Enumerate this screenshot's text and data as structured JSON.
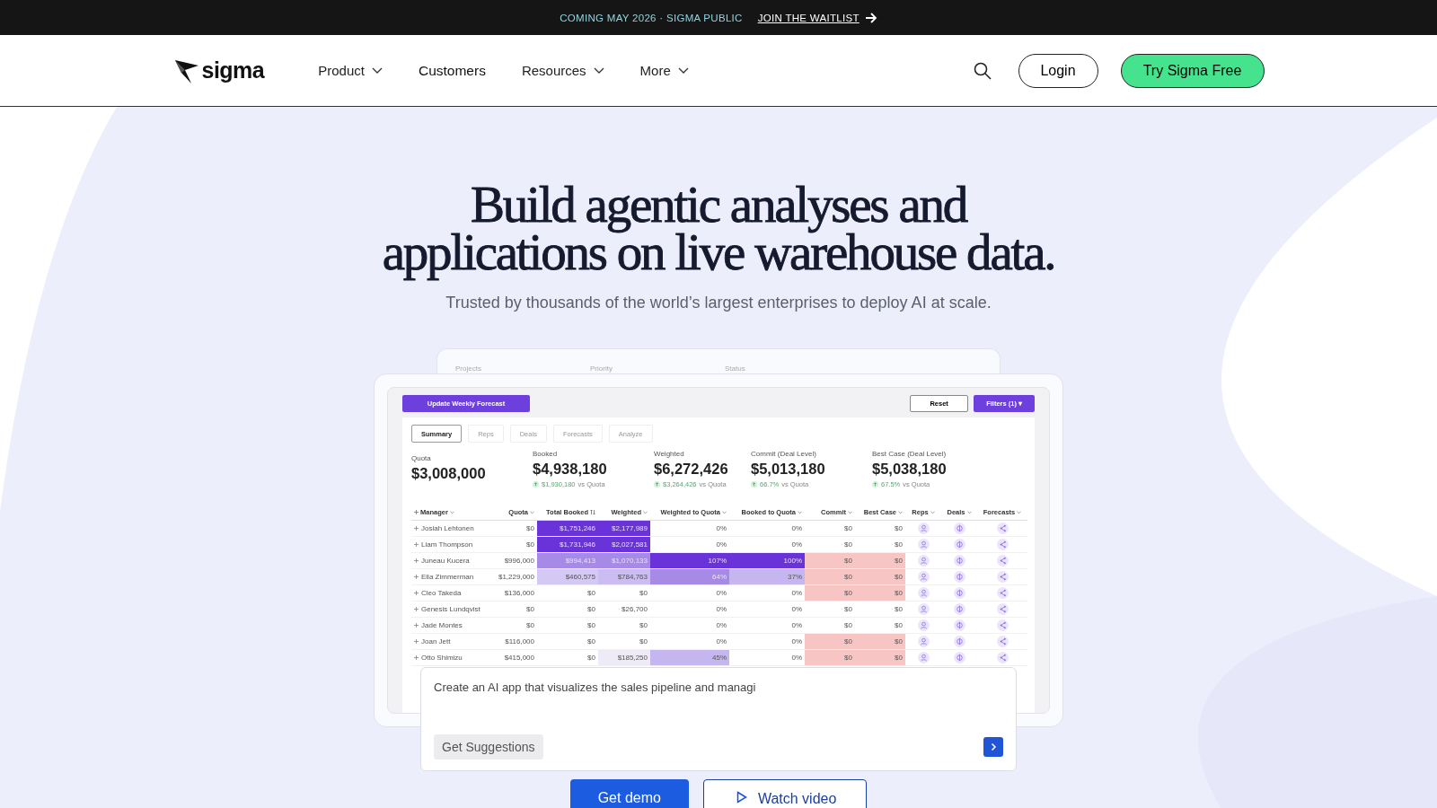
{
  "announcement": {
    "text": "COMING MAY 2026 · SIGMA PUBLIC",
    "link": "JOIN THE WAITLIST"
  },
  "nav": {
    "logo": "sigma",
    "items": [
      {
        "label": "Product",
        "dropdown": true
      },
      {
        "label": "Customers",
        "dropdown": false
      },
      {
        "label": "Resources",
        "dropdown": true
      },
      {
        "label": "More",
        "dropdown": true
      }
    ],
    "login": "Login",
    "cta": "Try Sigma Free"
  },
  "hero": {
    "title_lines": [
      "Build agentic analyses and",
      "applications on live warehouse data."
    ],
    "subtitle": "Trusted by thousands of the world’s largest enterprises to deploy AI at scale."
  },
  "dashboard": {
    "back_fields": [
      "Projects",
      "Priority",
      "Status"
    ],
    "action": "Update Weekly Forecast",
    "reset": "Reset",
    "filters": "Filters (1) ▾",
    "tabs": [
      {
        "label": "Summary",
        "selected": true
      },
      {
        "label": "Reps",
        "selected": false
      },
      {
        "label": "Deals",
        "selected": false
      },
      {
        "label": "Forecasts",
        "selected": false
      },
      {
        "label": "Analyze",
        "selected": false
      }
    ],
    "kpis": [
      {
        "label": "Quota",
        "value": "$3,008,000"
      },
      {
        "label": "Booked",
        "value": "$4,938,180",
        "delta": "$1,930,180",
        "note": "vs Quota"
      },
      {
        "label": "Weighted",
        "value": "$6,272,426",
        "delta": "$3,264,426",
        "note": "vs Quota"
      },
      {
        "label": "Commit (Deal Level)",
        "value": "$5,013,180",
        "delta": "66.7%",
        "note": "vs Quota"
      },
      {
        "label": "Best Case (Deal Level)",
        "value": "$5,038,180",
        "delta": "67.5%",
        "note": "vs Quota"
      }
    ],
    "table": {
      "columns": [
        {
          "label": "Manager",
          "sorted": false
        },
        {
          "label": "Quota",
          "sorted": false
        },
        {
          "label": "Total Booked",
          "sorted": true
        },
        {
          "label": "Weighted",
          "sorted": false
        },
        {
          "label": "Weighted to Quota",
          "sorted": false
        },
        {
          "label": "Booked to Quota",
          "sorted": false
        },
        {
          "label": "Commit",
          "sorted": false
        },
        {
          "label": "Best Case",
          "sorted": false
        },
        {
          "label": "Reps",
          "sorted": false
        },
        {
          "label": "Deals",
          "sorted": false
        },
        {
          "label": "Forecasts",
          "sorted": false
        }
      ],
      "rows": [
        {
          "cells": [
            {
              "text": "Josiah Lehtonen"
            },
            {
              "text": "$0"
            },
            {
              "text": "$1,751,246",
              "color": "#6a32d9"
            },
            {
              "text": "$2,177,989",
              "color": "#6a32d9"
            },
            {
              "text": "0%"
            },
            {
              "text": "0%"
            },
            {
              "text": "$0"
            },
            {
              "text": "$0"
            }
          ]
        },
        {
          "cells": [
            {
              "text": "Liam Thompson"
            },
            {
              "text": "$0"
            },
            {
              "text": "$1,731,946",
              "color": "#6a32d9"
            },
            {
              "text": "$2,027,581",
              "color": "#6a32d9"
            },
            {
              "text": "0%"
            },
            {
              "text": "0%"
            },
            {
              "text": "$0"
            },
            {
              "text": "$0"
            }
          ]
        },
        {
          "cells": [
            {
              "text": "Juneau Kucera"
            },
            {
              "text": "$996,000"
            },
            {
              "text": "$994,413",
              "color": "#a68ae6"
            },
            {
              "text": "$1,070,133",
              "color": "#a68ae6"
            },
            {
              "text": "107%",
              "color": "#6a32d9"
            },
            {
              "text": "100%",
              "color": "#6a32d9"
            },
            {
              "text": "$0",
              "color": "#f8c5c5"
            },
            {
              "text": "$0",
              "color": "#f8c5c5"
            }
          ]
        },
        {
          "cells": [
            {
              "text": "Ella Zimmerman"
            },
            {
              "text": "$1,229,000"
            },
            {
              "text": "$460,575",
              "color": "#d4c8f4"
            },
            {
              "text": "$784,763",
              "color": "#cbbcf2"
            },
            {
              "text": "64%",
              "color": "#a68ae6"
            },
            {
              "text": "37%",
              "color": "#c6b6f0"
            },
            {
              "text": "$0",
              "color": "#f8c5c5"
            },
            {
              "text": "$0",
              "color": "#f8c5c5"
            }
          ]
        },
        {
          "cells": [
            {
              "text": "Cleo Takeda"
            },
            {
              "text": "$136,000"
            },
            {
              "text": "$0"
            },
            {
              "text": "$0"
            },
            {
              "text": "0%"
            },
            {
              "text": "0%"
            },
            {
              "text": "$0",
              "color": "#f8c5c5"
            },
            {
              "text": "$0",
              "color": "#f8c5c5"
            }
          ]
        },
        {
          "cells": [
            {
              "text": "Genesis Lundqvist"
            },
            {
              "text": "$0"
            },
            {
              "text": "$0"
            },
            {
              "text": "$26,700"
            },
            {
              "text": "0%"
            },
            {
              "text": "0%"
            },
            {
              "text": "$0"
            },
            {
              "text": "$0"
            }
          ]
        },
        {
          "cells": [
            {
              "text": "Jade Montes"
            },
            {
              "text": "$0"
            },
            {
              "text": "$0"
            },
            {
              "text": "$0"
            },
            {
              "text": "0%"
            },
            {
              "text": "0%"
            },
            {
              "text": "$0"
            },
            {
              "text": "$0"
            }
          ]
        },
        {
          "cells": [
            {
              "text": "Joan Jett"
            },
            {
              "text": "$116,000"
            },
            {
              "text": "$0"
            },
            {
              "text": "$0"
            },
            {
              "text": "0%"
            },
            {
              "text": "0%"
            },
            {
              "text": "$0",
              "color": "#f8c5c5"
            },
            {
              "text": "$0",
              "color": "#f8c5c5"
            }
          ]
        },
        {
          "cells": [
            {
              "text": "Otto Shimizu"
            },
            {
              "text": "$415,000"
            },
            {
              "text": "$0"
            },
            {
              "text": "$185,250",
              "color": "#eeebf7"
            },
            {
              "text": "45%",
              "color": "#c6b6f0"
            },
            {
              "text": "0%"
            },
            {
              "text": "$0",
              "color": "#f8c5c5"
            },
            {
              "text": "$0",
              "color": "#f8c5c5"
            }
          ]
        }
      ]
    }
  },
  "prompt": {
    "value": "Create an AI app that visualizes the sales pipeline and managi",
    "suggestions": "Get Suggestions"
  },
  "actions": [
    {
      "label": "Get demo",
      "kind": "primary"
    },
    {
      "label": "Watch video",
      "kind": "video"
    }
  ]
}
